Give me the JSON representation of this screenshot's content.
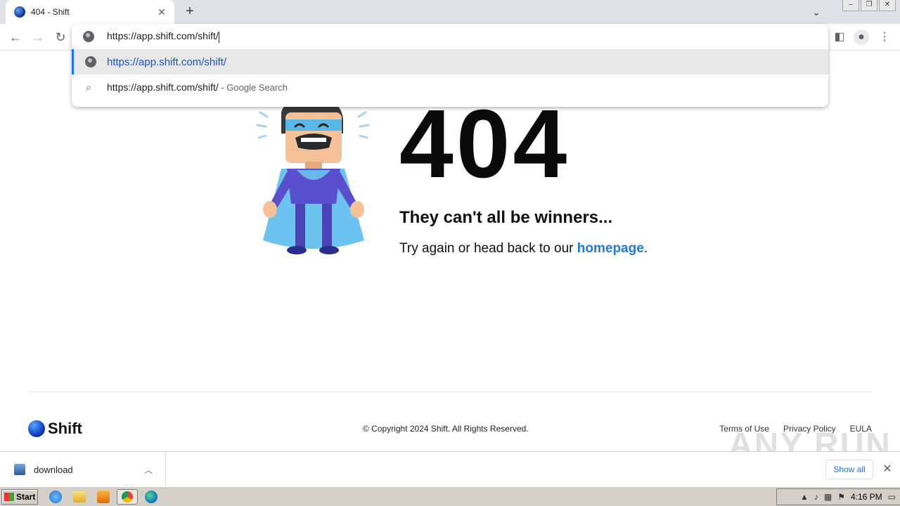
{
  "browser": {
    "tab_title": "404 - Shift",
    "tab_close": "✕",
    "new_tab": "+",
    "omnibox": {
      "input_value": "https://app.shift.com/shift/",
      "suggestions": [
        {
          "text": "https://app.shift.com/shift/",
          "suffix": ""
        },
        {
          "text": "https://app.shift.com/shift/",
          "suffix": " - Google Search"
        }
      ]
    }
  },
  "page": {
    "error_code": "404",
    "title": "They can't all be winners...",
    "message_before": "Try again or head back to our ",
    "link_text": "homepage",
    "message_after": "."
  },
  "footer": {
    "logo_text": "Shift",
    "copyright": "© Copyright 2024 Shift. All Rights Reserved.",
    "links": [
      "Terms of Use",
      "Privacy Policy",
      "EULA"
    ]
  },
  "downloads": {
    "file_name": "download",
    "show_all": "Show all"
  },
  "watermark": "ANY RUN",
  "taskbar": {
    "start_label": "Start",
    "clock": "4:16 PM"
  },
  "colors": {
    "link": "#1f7bd8",
    "omnibox_url": "#1a56c2",
    "accent": "#1a73e8"
  }
}
